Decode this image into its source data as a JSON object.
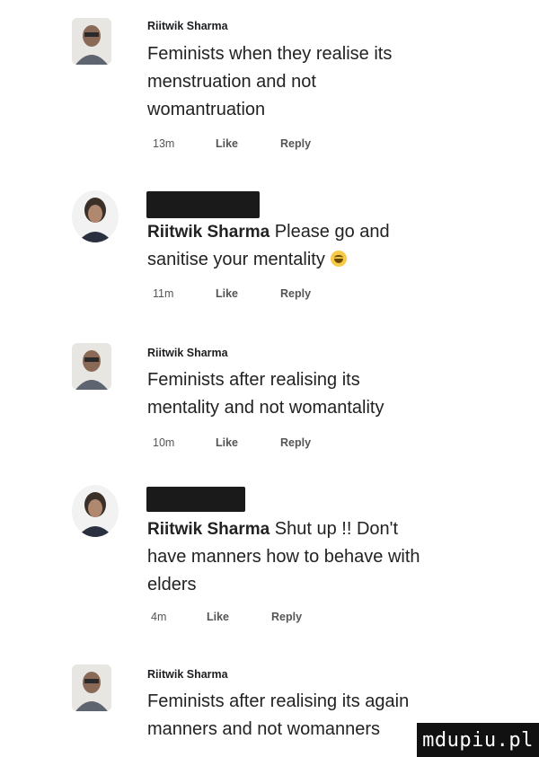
{
  "comments": [
    {
      "author": "Riitwik Sharma",
      "text": "Feminists when they realise its menstruation and not womantruation",
      "line1": "Feminists when they realise its",
      "line2": "menstruation and not",
      "line3": "womantruation",
      "time": "13m",
      "like": "Like",
      "reply": "Reply"
    },
    {
      "author": "Riitwik Sharma",
      "text": "Please go and sanitise your mentality",
      "line1": "Please go and",
      "line2": "sanitise your mentality",
      "emoji": "grinning-sweat-emoji",
      "time": "11m",
      "like": "Like",
      "reply": "Reply"
    },
    {
      "author": "Riitwik Sharma",
      "line1": "Feminists after realising its",
      "line2": "mentality and not womantality",
      "time": "10m",
      "like": "Like",
      "reply": "Reply"
    },
    {
      "author": "Riitwik Sharma",
      "line1": "Shut up !! Don't",
      "line2": "have manners how to behave with",
      "line3": "elders",
      "time": "4m",
      "like": "Like",
      "reply": "Reply"
    },
    {
      "author": "Riitwik Sharma",
      "line1": "Feminists after realising its again",
      "line2": "manners and not womanners"
    }
  ],
  "watermark": "mdupiu.pl"
}
